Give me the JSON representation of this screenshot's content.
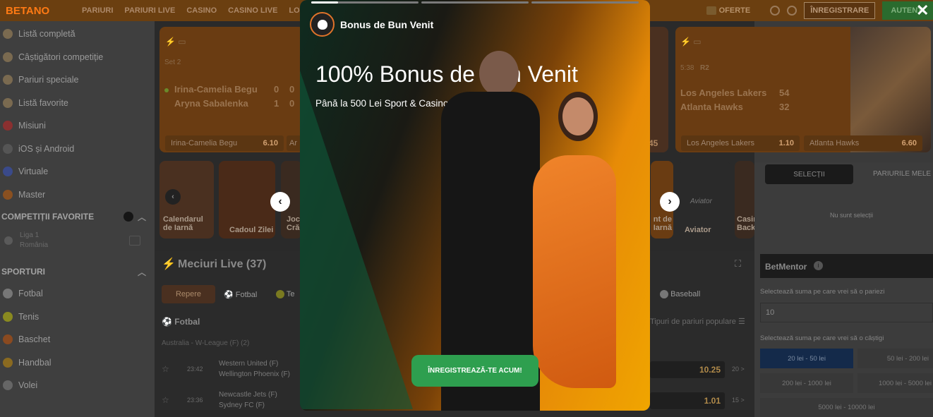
{
  "topbar": {
    "logo": "BETANO",
    "nav": [
      "PARIURI",
      "PARIURI LIVE",
      "CASINO",
      "CASINO LIVE",
      "LOTO"
    ],
    "oferte": "OFERTE",
    "register": "ÎNREGISTRARE",
    "auth": "AUTENTI"
  },
  "sidebar": {
    "items": [
      "Listă completă",
      "Câștigători competiție",
      "Pariuri speciale",
      "Listă favorite",
      "Misiuni",
      "iOS și Android",
      "Virtuale",
      "Master"
    ],
    "fav_header": "COMPETIȚII FAVORITE",
    "fav_item": {
      "name": "Liga 1",
      "country": "România"
    },
    "sports_header": "SPORTURI",
    "sports": [
      "Fotbal",
      "Tenis",
      "Baschet",
      "Handbal",
      "Volei"
    ]
  },
  "live_cards": [
    {
      "set": "Set 2",
      "p1": "Irina-Camelia Begu",
      "p1_s1": "0",
      "p1_s2": "0",
      "p2": "Aryna Sabalenka",
      "p2_s1": "1",
      "p2_s2": "0",
      "bet_name": "Irina-Camelia Begu",
      "bet_odd": "6.10",
      "bet2_name": "Ar"
    },
    {
      "time": "5:38",
      "quarter": "R2",
      "t1": "Los Angeles Lakers",
      "t1_score": "54",
      "t2": "Atlanta Hawks",
      "t2_score": "32",
      "bet1_name": "Los Angeles Lakers",
      "bet1_odd": "1.10",
      "bet2_name": "Atlanta Hawks",
      "bet2_odd": "6.60"
    },
    {
      "partial": "45"
    }
  ],
  "promos": [
    "Calendarul de Iarnă",
    "Cadoul Zilei",
    "Jocu Crăci",
    "nt de Iarnă",
    "Aviator",
    "Casin Back"
  ],
  "promos_aviator_logo": "Aviator",
  "live": {
    "title": "Meciuri Live (37)",
    "sports": [
      "Repere",
      "Fotbal",
      "Te",
      "Baseball"
    ],
    "section": "Fotbal",
    "markets": "Tipuri de pariuri populare",
    "league": "Australia - W-League (F) (2)",
    "matches": [
      {
        "time": "23:42",
        "home": "Western United (F)",
        "away": "Wellington Phoenix (F)",
        "odd": "10.25",
        "more": "20 >"
      },
      {
        "time": "23:36",
        "home": "Newcastle Jets (F)",
        "away": "Sydney FC (F)",
        "odd": "1.01",
        "more": "15 >"
      }
    ]
  },
  "betslip": {
    "tab1": "SELECȚII",
    "tab2": "PARIURILE MELE",
    "empty": "Nu sunt selecții"
  },
  "betmentor": {
    "title": "BetMentor",
    "stake_label": "Selectează suma pe care vrei să o pariezi",
    "stake_value": "10",
    "win_label": "Selectează suma pe care vrei să o câștigi",
    "ranges": [
      "20 lei - 50 lei",
      "50 lei - 200 lei",
      "200 lei - 1000 lei",
      "1000 lei - 5000 lei",
      "5000 lei - 10000 lei"
    ]
  },
  "story": {
    "avatar_icon": "money-bag-icon",
    "header": "Bonus de Bun Venit",
    "title": "100% Bonus de Bun Venit",
    "subtitle": "Până la 500 Lei Sport & Casino",
    "cta": "ÎNREGISTREAZĂ-TE ACUM!",
    "progress": [
      0.25,
      0,
      0
    ]
  },
  "close_icon": "✕"
}
